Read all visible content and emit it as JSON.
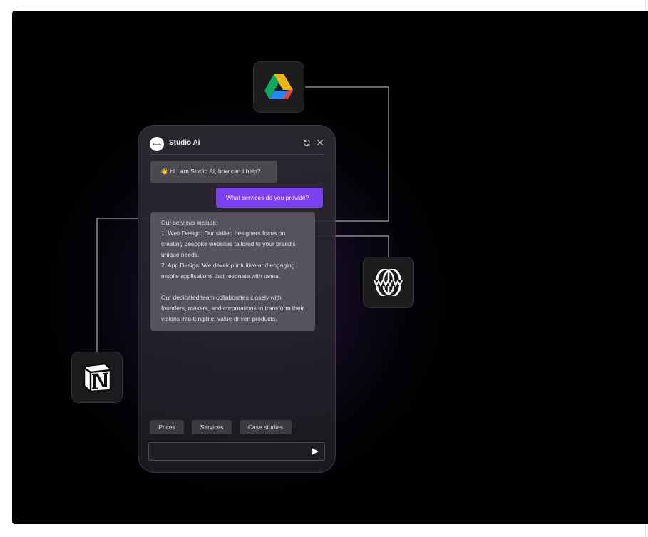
{
  "chat": {
    "app_title": "Studio Ai",
    "avatar_text": "Studio",
    "greeting": "👋 Hi I am Studio AI, how can I help?",
    "user_message": "What services do you provide?",
    "answer": "Our services include:\n1. Web Design: Our skilled designers focus on creating bespoke websites tailored to your brand's unique needs.\n2. App Design: We develop intuitive and engaging mobile applications that resonate with users.\n\nOur dedicated team collaborates closely with founders, makers, and corporations to transform their visions into tangible, value-driven products.",
    "quick_replies": [
      "Prices",
      "Services",
      "Case studies"
    ],
    "input_value": "",
    "input_placeholder": ""
  },
  "integrations": {
    "drive_icon": "google-drive-icon",
    "web_icon": "www-globe-icon",
    "notion_icon": "notion-icon"
  },
  "colors": {
    "background": "#000000",
    "accent": "#7d3ff2",
    "bubble_bot": "#4a4950",
    "bubble_answer": "#57525f"
  }
}
